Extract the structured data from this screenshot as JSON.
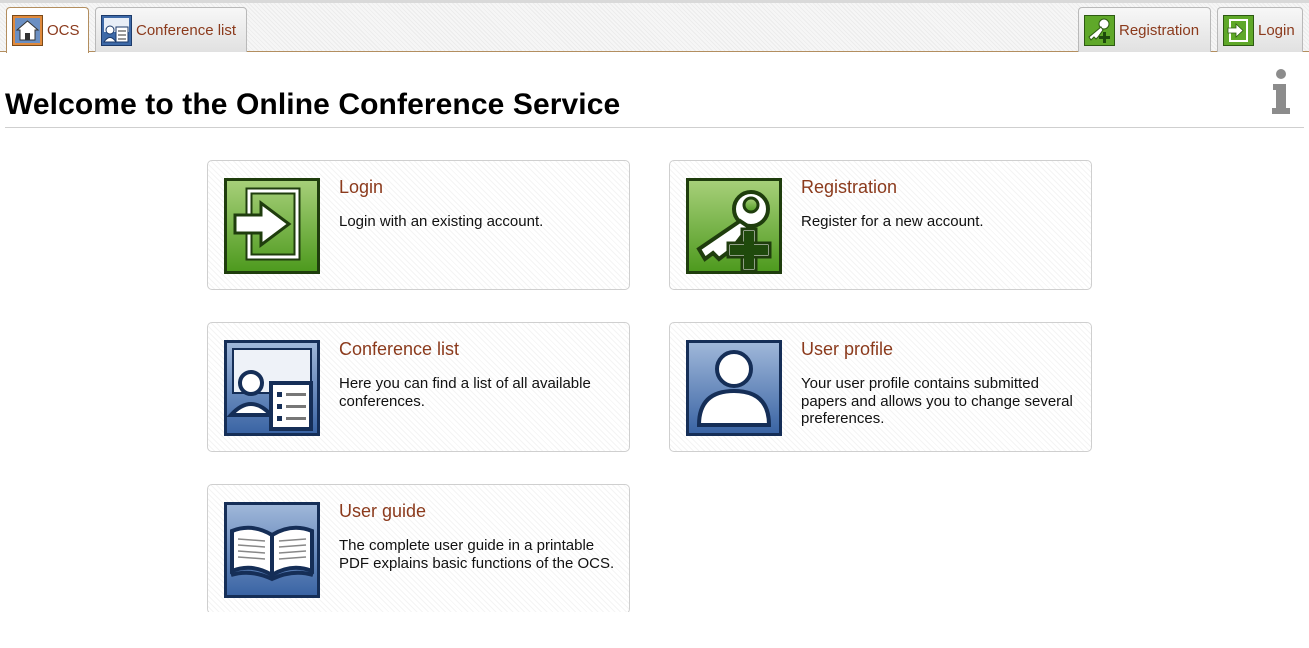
{
  "nav": {
    "tabs": [
      {
        "label": "OCS",
        "icon": "home-icon",
        "active": true
      },
      {
        "label": "Conference list",
        "icon": "conference-list-icon",
        "active": false
      }
    ],
    "right_tabs": [
      {
        "label": "Registration",
        "icon": "registration-icon"
      },
      {
        "label": "Login",
        "icon": "login-icon"
      }
    ]
  },
  "page": {
    "title": "Welcome to the Online Conference Service",
    "info_icon": "info-icon"
  },
  "cards": [
    {
      "title": "Login",
      "description": "Login with an existing account.",
      "icon": "login-icon"
    },
    {
      "title": "Registration",
      "description": "Register for a new account.",
      "icon": "registration-icon"
    },
    {
      "title": "Conference list",
      "description": "Here you can find a list of all available conferences.",
      "icon": "conference-list-icon"
    },
    {
      "title": "User profile",
      "description": "Your user profile contains submitted papers and allows you to change several preferences.",
      "icon": "user-profile-icon"
    },
    {
      "title": "User guide",
      "description": "The complete user guide in a printable PDF explains basic functions of the OCS.",
      "icon": "user-guide-icon"
    }
  ],
  "colors": {
    "link": "#8b3a1c",
    "tab_border_active": "#b38e5f",
    "green_icon": "#5fa829",
    "blue_icon": "#3e6aa8"
  }
}
